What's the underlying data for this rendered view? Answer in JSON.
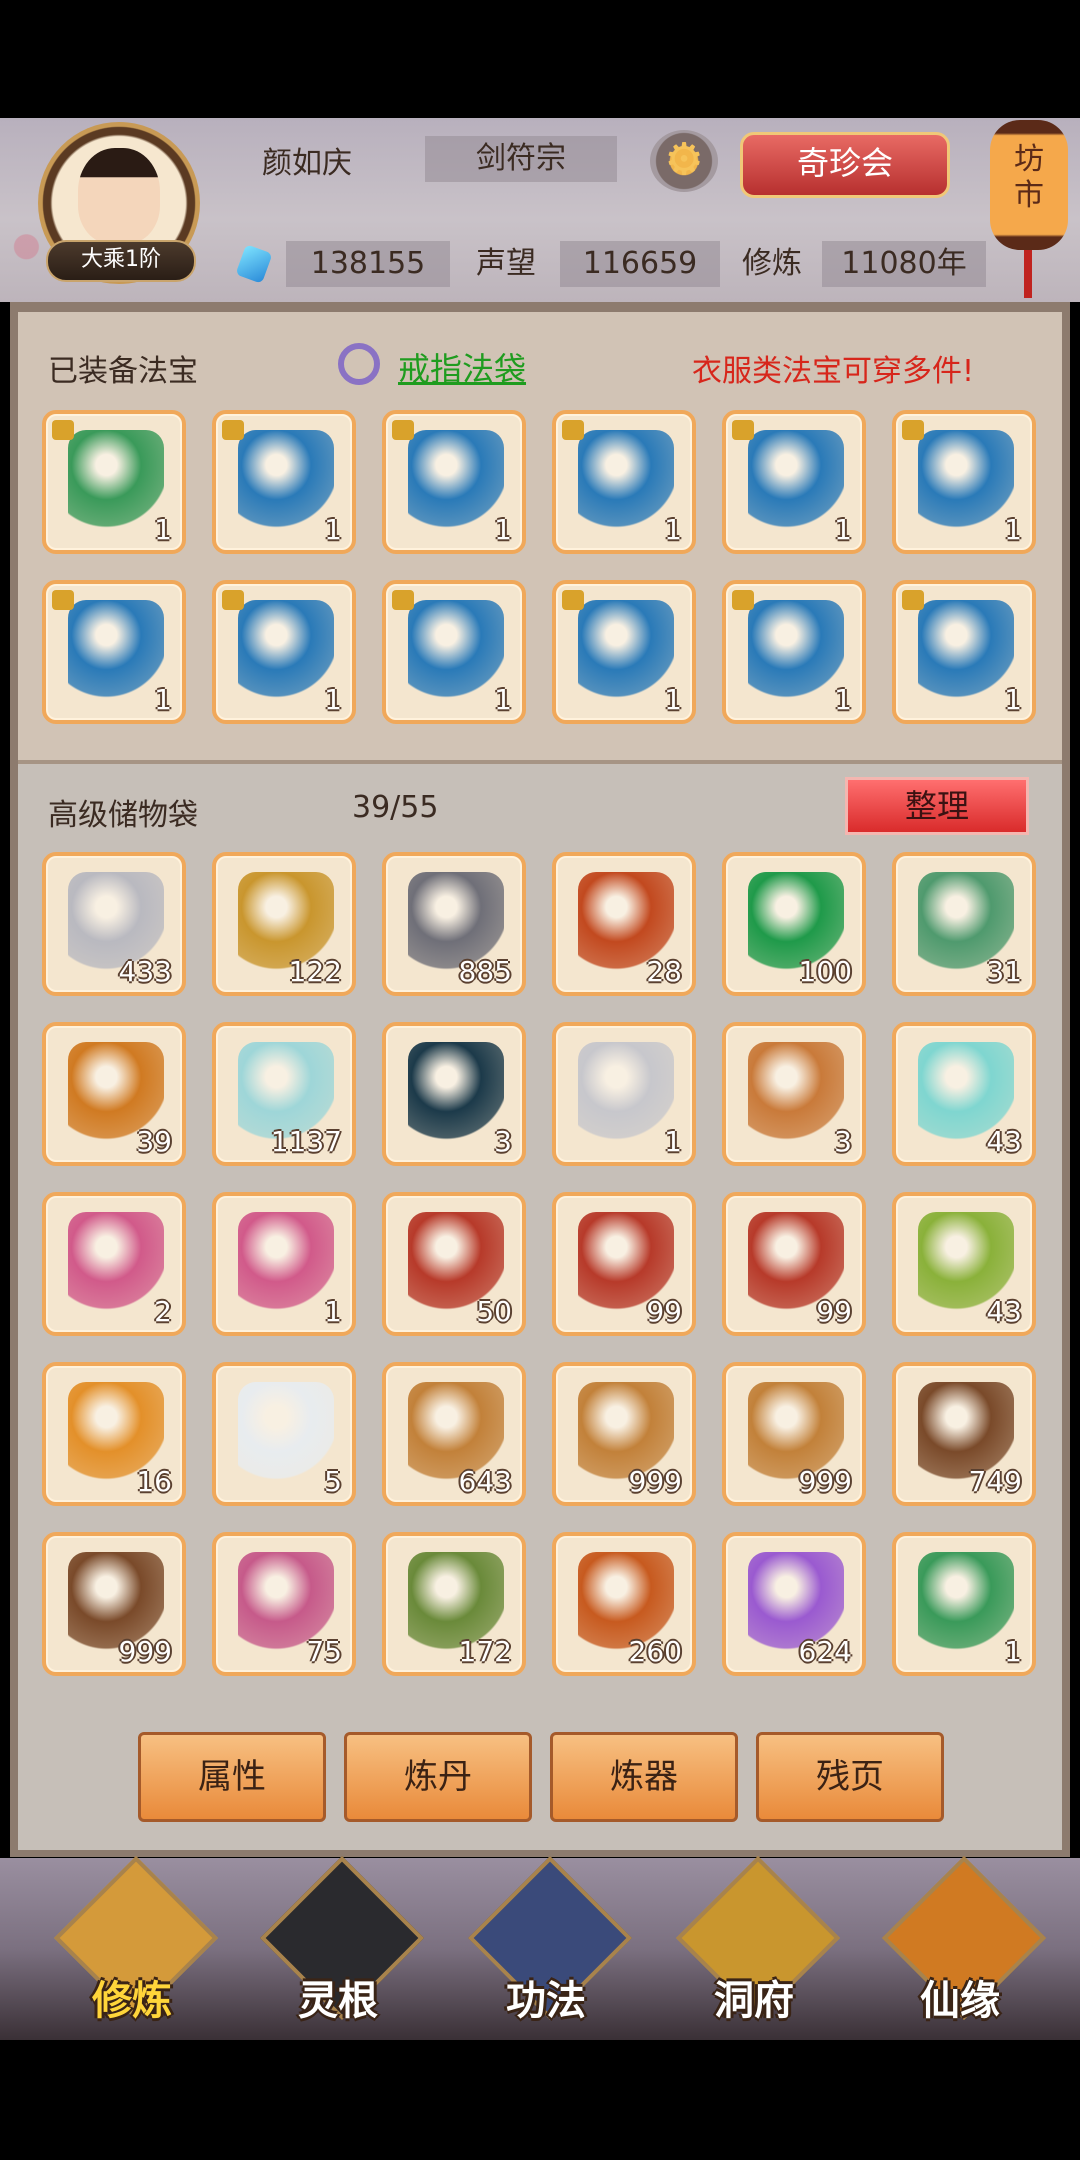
{
  "header": {
    "name": "颜如庆",
    "sect": "剑符宗",
    "rank": "大乘1阶",
    "treasure_button": "奇珍会",
    "market_label": "坊市",
    "gems": "138155",
    "reputation_label": "声望",
    "reputation": "116659",
    "cultivation_label": "修炼",
    "cultivation": "11080年"
  },
  "equipped": {
    "title": "已装备法宝",
    "ring_bag_link": "戒指法袋",
    "notice": "衣服类法宝可穿多件!",
    "items": [
      {
        "icon": "green-armor-icon",
        "count": "1"
      },
      {
        "icon": "blue-robe-icon",
        "count": "1"
      },
      {
        "icon": "blue-robe-icon",
        "count": "1"
      },
      {
        "icon": "blue-robe-icon",
        "count": "1"
      },
      {
        "icon": "blue-robe-icon",
        "count": "1"
      },
      {
        "icon": "blue-robe-icon",
        "count": "1"
      },
      {
        "icon": "blue-robe-icon",
        "count": "1"
      },
      {
        "icon": "blue-robe-icon",
        "count": "1"
      },
      {
        "icon": "blue-robe-icon",
        "count": "1"
      },
      {
        "icon": "blue-robe-icon",
        "count": "1"
      },
      {
        "icon": "blue-robe-icon",
        "count": "1"
      },
      {
        "icon": "blue-robe-icon",
        "count": "1"
      }
    ]
  },
  "storage": {
    "title": "高级储物袋",
    "capacity": "39/55",
    "sort_button": "整理",
    "items": [
      {
        "icon": "silver-ore-icon",
        "count": "433",
        "color": "#b9b9c0"
      },
      {
        "icon": "gold-ore-icon",
        "count": "122",
        "color": "#c9962e"
      },
      {
        "icon": "iron-ore-icon",
        "count": "885",
        "color": "#6f6f78"
      },
      {
        "icon": "red-crystal-icon",
        "count": "28",
        "color": "#c2491f"
      },
      {
        "icon": "green-crystal-icon",
        "count": "100",
        "color": "#1f9a4a"
      },
      {
        "icon": "green-gourd-icon",
        "count": "31",
        "color": "#4f9a6e"
      },
      {
        "icon": "wine-gourd-icon",
        "count": "39",
        "color": "#d07a22"
      },
      {
        "icon": "porcelain-bottle-icon",
        "count": "1137",
        "color": "#9ed6d8"
      },
      {
        "icon": "star-map-icon",
        "count": "3",
        "color": "#1c3a4a"
      },
      {
        "icon": "silver-egg-icon",
        "count": "1",
        "color": "#c7c7cc"
      },
      {
        "icon": "bronze-ring-icon",
        "count": "3",
        "color": "#c97a3a"
      },
      {
        "icon": "jade-gourd-icon",
        "count": "43",
        "color": "#7fd6d0"
      },
      {
        "icon": "scroll-icon",
        "count": "2",
        "color": "#d15a8a"
      },
      {
        "icon": "scroll-icon",
        "count": "1",
        "color": "#d15a8a"
      },
      {
        "icon": "red-orb-icon",
        "count": "50",
        "color": "#b73a2a"
      },
      {
        "icon": "red-orb-icon",
        "count": "99",
        "color": "#b73a2a"
      },
      {
        "icon": "red-orb-icon",
        "count": "99",
        "color": "#b73a2a"
      },
      {
        "icon": "green-orb-icon",
        "count": "43",
        "color": "#8ab13a"
      },
      {
        "icon": "crystal-ball-stand-icon",
        "count": "16",
        "color": "#e3902a"
      },
      {
        "icon": "white-flower-icon",
        "count": "5",
        "color": "#e8ecef"
      },
      {
        "icon": "ginseng-root-icon",
        "count": "643",
        "color": "#c2813a"
      },
      {
        "icon": "ginseng-root-icon",
        "count": "999",
        "color": "#c2813a"
      },
      {
        "icon": "ginseng-root-icon",
        "count": "999",
        "color": "#c2813a"
      },
      {
        "icon": "herb-root-icon",
        "count": "749",
        "color": "#7a4a2a"
      },
      {
        "icon": "herb-root-icon",
        "count": "999",
        "color": "#7a4a2a"
      },
      {
        "icon": "pink-herb-icon",
        "count": "75",
        "color": "#c65a8a"
      },
      {
        "icon": "spirit-branch-icon",
        "count": "172",
        "color": "#6a8a3a"
      },
      {
        "icon": "red-cordyceps-icon",
        "count": "260",
        "color": "#c75a1f"
      },
      {
        "icon": "purple-orchid-icon",
        "count": "624",
        "color": "#9a5ad0"
      },
      {
        "icon": "green-armor-icon",
        "count": "1",
        "color": "#3a9a5a"
      }
    ]
  },
  "actions": [
    "属性",
    "炼丹",
    "炼器",
    "残页"
  ],
  "nav": [
    {
      "label": "修炼",
      "icon": "cultivate-icon",
      "active": true
    },
    {
      "label": "灵根",
      "icon": "spirit-root-icon",
      "active": false
    },
    {
      "label": "功法",
      "icon": "technique-book-icon",
      "active": false
    },
    {
      "label": "洞府",
      "icon": "cave-mansion-icon",
      "active": false
    },
    {
      "label": "仙缘",
      "icon": "fate-gourd-icon",
      "active": false
    }
  ]
}
